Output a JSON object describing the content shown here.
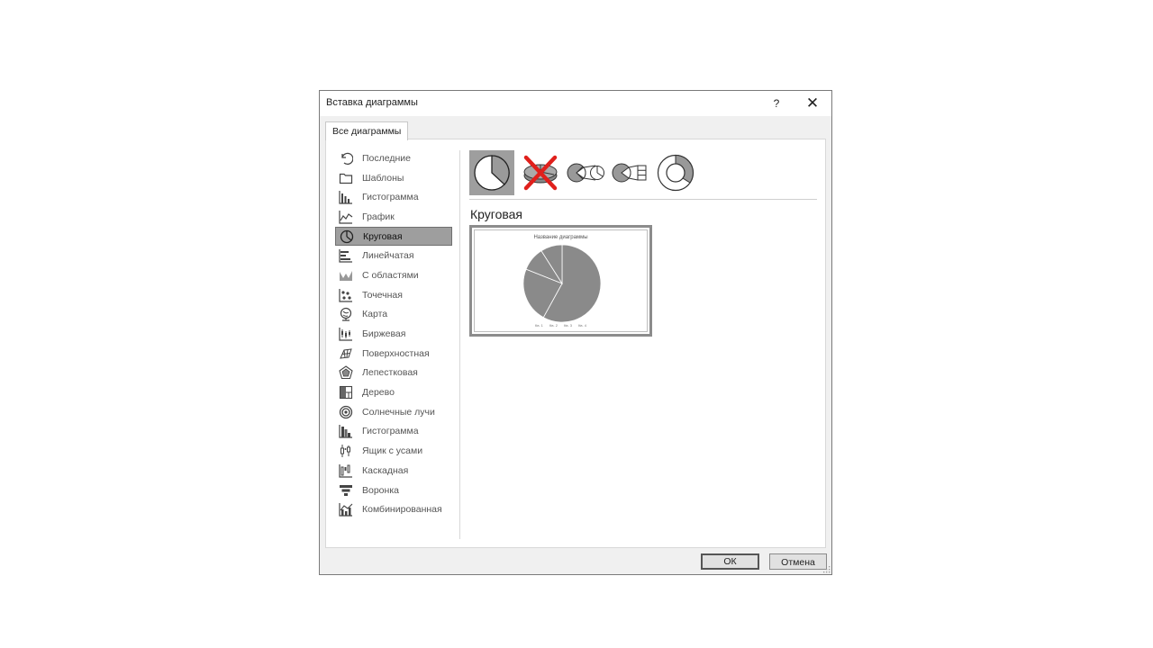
{
  "dialog": {
    "title": "Вставка диаграммы",
    "help": "?",
    "close": "✕",
    "tab": "Все диаграммы"
  },
  "sidebar": {
    "items": [
      {
        "label": "Последние",
        "icon": "recent-icon"
      },
      {
        "label": "Шаблоны",
        "icon": "folder-icon"
      },
      {
        "label": "Гистограмма",
        "icon": "column-chart-icon"
      },
      {
        "label": "График",
        "icon": "line-chart-icon"
      },
      {
        "label": "Круговая",
        "icon": "pie-chart-icon",
        "selected": true
      },
      {
        "label": "Линейчатая",
        "icon": "bar-chart-icon"
      },
      {
        "label": "С областями",
        "icon": "area-chart-icon"
      },
      {
        "label": "Точечная",
        "icon": "scatter-chart-icon"
      },
      {
        "label": "Карта",
        "icon": "map-chart-icon"
      },
      {
        "label": "Биржевая",
        "icon": "stock-chart-icon"
      },
      {
        "label": "Поверхностная",
        "icon": "surface-chart-icon"
      },
      {
        "label": "Лепестковая",
        "icon": "radar-chart-icon"
      },
      {
        "label": "Дерево",
        "icon": "treemap-chart-icon"
      },
      {
        "label": "Солнечные лучи",
        "icon": "sunburst-chart-icon"
      },
      {
        "label": "Гистограмма",
        "icon": "histogram-chart-icon"
      },
      {
        "label": "Ящик с усами",
        "icon": "box-whisker-chart-icon"
      },
      {
        "label": "Каскадная",
        "icon": "waterfall-chart-icon"
      },
      {
        "label": "Воронка",
        "icon": "funnel-chart-icon"
      },
      {
        "label": "Комбинированная",
        "icon": "combo-chart-icon"
      }
    ]
  },
  "subtypes": [
    {
      "icon": "pie-subtype-icon",
      "selected": true
    },
    {
      "icon": "pie-3d-subtype-crossed-icon"
    },
    {
      "icon": "pie-of-pie-subtype-icon"
    },
    {
      "icon": "bar-of-pie-subtype-icon"
    },
    {
      "icon": "doughnut-subtype-icon"
    }
  ],
  "main": {
    "section_title": "Круговая",
    "preview_title": "Название диаграммы",
    "legend": [
      "Кв. 1",
      "Кв. 2",
      "Кв. 3",
      "Кв. 4"
    ]
  },
  "buttons": {
    "ok": "ОК",
    "cancel": "Отмена"
  },
  "colors": {
    "selected_bg": "#9e9e9e",
    "pie_fill": "#8a8a8a",
    "cross": "#e0201c"
  },
  "chart_data": {
    "type": "pie",
    "title": "Название диаграммы",
    "categories": [
      "Кв. 1",
      "Кв. 2",
      "Кв. 3",
      "Кв. 4"
    ],
    "values": [
      58,
      23,
      10,
      9
    ]
  }
}
